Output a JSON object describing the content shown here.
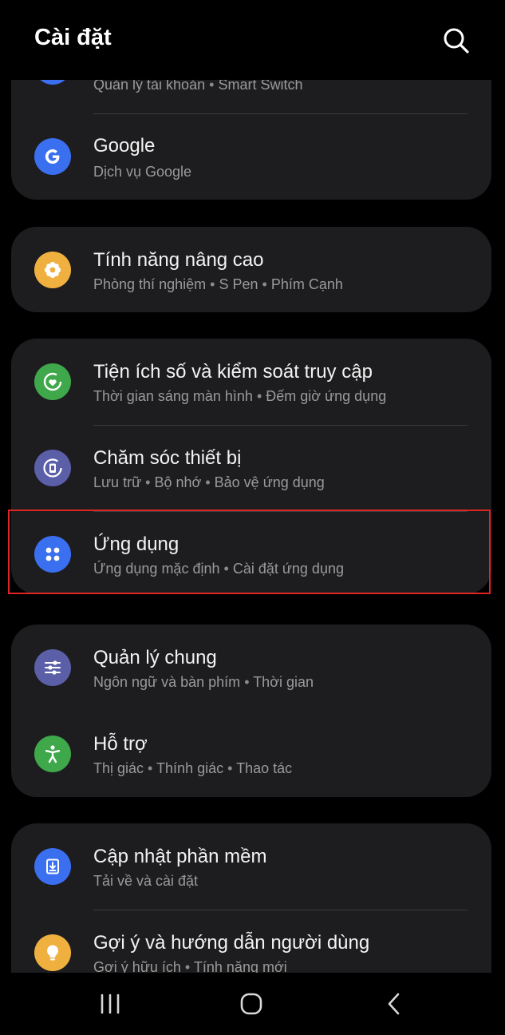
{
  "header": {
    "title": "Cài đặt",
    "search_icon": "search-icon"
  },
  "groups": [
    {
      "items": [
        {
          "id": "accounts",
          "label": "",
          "sub": [
            "Quản lý tài khoản",
            "Smart Switch"
          ],
          "icon": "account-icon",
          "color": "#3a6ff0"
        },
        {
          "id": "google",
          "label": "Google",
          "sub": [
            "Dịch vụ Google"
          ],
          "icon": "google-icon",
          "color": "#3a6ff0"
        }
      ]
    },
    {
      "items": [
        {
          "id": "advanced",
          "label": "Tính năng nâng cao",
          "sub": [
            "Phòng thí nghiệm",
            "S Pen",
            "Phím Cạnh"
          ],
          "icon": "gear-flower-icon",
          "color": "#f0b040"
        }
      ]
    },
    {
      "items": [
        {
          "id": "wellbeing",
          "label": "Tiện ích số và kiểm soát truy cập",
          "sub": [
            "Thời gian sáng màn hình",
            "Đếm giờ ứng dụng"
          ],
          "icon": "heart-ring-icon",
          "color": "#3ea84a"
        },
        {
          "id": "device-care",
          "label": "Chăm sóc thiết bị",
          "sub": [
            "Lưu trữ",
            "Bộ nhớ",
            "Bảo vệ ứng dụng"
          ],
          "icon": "device-care-icon",
          "color": "#5a5fa8"
        },
        {
          "id": "apps",
          "label": "Ứng dụng",
          "sub": [
            "Ứng dụng mặc định",
            "Cài đặt ứng dụng"
          ],
          "icon": "apps-grid-icon",
          "color": "#3a6ff0"
        }
      ]
    },
    {
      "items": [
        {
          "id": "general",
          "label": "Quản lý chung",
          "sub": [
            "Ngôn ngữ và bàn phím",
            "Thời gian"
          ],
          "icon": "sliders-icon",
          "color": "#5a5fa8"
        },
        {
          "id": "accessibility",
          "label": "Hỗ trợ",
          "sub": [
            "Thị giác",
            "Thính giác",
            "Thao tác"
          ],
          "icon": "accessibility-icon",
          "color": "#3ea84a"
        }
      ]
    },
    {
      "items": [
        {
          "id": "software-update",
          "label": "Cập nhật phần mềm",
          "sub": [
            "Tải về và cài đặt"
          ],
          "icon": "download-icon",
          "color": "#3a6ff0"
        },
        {
          "id": "tips",
          "label": "Gợi ý và hướng dẫn người dùng",
          "sub": [
            "Gợi ý hữu ích",
            "Tính năng mới"
          ],
          "icon": "lightbulb-icon",
          "color": "#f0b040"
        }
      ]
    }
  ],
  "separator": "•",
  "highlight_color": "#e02424",
  "navbar": {
    "recents_icon": "recents-icon",
    "home_icon": "home-icon",
    "back_icon": "back-icon"
  }
}
